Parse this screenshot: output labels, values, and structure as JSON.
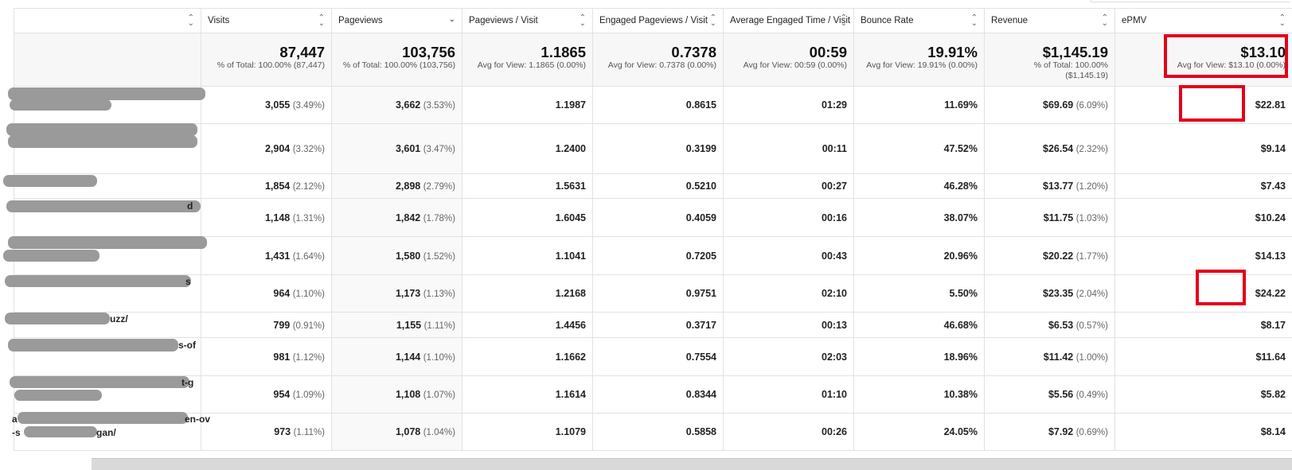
{
  "columns": [
    {
      "label": "",
      "sort": "both"
    },
    {
      "label": "Visits",
      "sort": "both"
    },
    {
      "label": "Pageviews",
      "sort": "down"
    },
    {
      "label": "Pageviews / Visit",
      "sort": "both"
    },
    {
      "label": "Engaged Pageviews / Visit",
      "sort": "both"
    },
    {
      "label": "Average Engaged Time / Visit",
      "sort": "both"
    },
    {
      "label": "Bounce Rate",
      "sort": "both"
    },
    {
      "label": "Revenue",
      "sort": "both"
    },
    {
      "label": "ePMV",
      "sort": "both"
    }
  ],
  "totals": {
    "visits": {
      "value": "87,447",
      "sub": "% of Total: 100.00% (87,447)"
    },
    "pageviews": {
      "value": "103,756",
      "sub": "% of Total: 100.00% (103,756)"
    },
    "pv_visit": {
      "value": "1.1865",
      "sub": "Avg for View: 1.1865 (0.00%)"
    },
    "engaged_pv": {
      "value": "0.7378",
      "sub": "Avg for View: 0.7378 (0.00%)"
    },
    "engaged_time": {
      "value": "00:59",
      "sub": "Avg for View: 00:59 (0.00%)"
    },
    "bounce": {
      "value": "19.91%",
      "sub": "Avg for View: 19.91% (0.00%)"
    },
    "revenue": {
      "value": "$1,145.19",
      "sub": "% of Total: 100.00%",
      "sub2": "($1,145.19)"
    },
    "epmv": {
      "value": "$13.10",
      "sub": "Avg for View: $13.10 (0.00%)"
    }
  },
  "rows": [
    {
      "visits": "3,055",
      "visits_pct": "(3.49%)",
      "pageviews": "3,662",
      "pageviews_pct": "(3.53%)",
      "pv_visit": "1.1987",
      "engaged_pv": "0.8615",
      "engaged_time": "01:29",
      "bounce": "11.69%",
      "revenue": "$69.69",
      "revenue_pct": "(6.09%)",
      "epmv": "$22.81"
    },
    {
      "visits": "2,904",
      "visits_pct": "(3.32%)",
      "pageviews": "3,601",
      "pageviews_pct": "(3.47%)",
      "pv_visit": "1.2400",
      "engaged_pv": "0.3199",
      "engaged_time": "00:11",
      "bounce": "47.52%",
      "revenue": "$26.54",
      "revenue_pct": "(2.32%)",
      "epmv": "$9.14"
    },
    {
      "visits": "1,854",
      "visits_pct": "(2.12%)",
      "pageviews": "2,898",
      "pageviews_pct": "(2.79%)",
      "pv_visit": "1.5631",
      "engaged_pv": "0.5210",
      "engaged_time": "00:27",
      "bounce": "46.28%",
      "revenue": "$13.77",
      "revenue_pct": "(1.20%)",
      "epmv": "$7.43"
    },
    {
      "visits": "1,148",
      "visits_pct": "(1.31%)",
      "pageviews": "1,842",
      "pageviews_pct": "(1.78%)",
      "pv_visit": "1.6045",
      "engaged_pv": "0.4059",
      "engaged_time": "00:16",
      "bounce": "38.07%",
      "revenue": "$11.75",
      "revenue_pct": "(1.03%)",
      "epmv": "$10.24"
    },
    {
      "visits": "1,431",
      "visits_pct": "(1.64%)",
      "pageviews": "1,580",
      "pageviews_pct": "(1.52%)",
      "pv_visit": "1.1041",
      "engaged_pv": "0.7205",
      "engaged_time": "00:43",
      "bounce": "20.96%",
      "revenue": "$20.22",
      "revenue_pct": "(1.77%)",
      "epmv": "$14.13"
    },
    {
      "visits": "964",
      "visits_pct": "(1.10%)",
      "pageviews": "1,173",
      "pageviews_pct": "(1.13%)",
      "pv_visit": "1.2168",
      "engaged_pv": "0.9751",
      "engaged_time": "02:10",
      "bounce": "5.50%",
      "revenue": "$23.35",
      "revenue_pct": "(2.04%)",
      "epmv": "$24.22"
    },
    {
      "visits": "799",
      "visits_pct": "(0.91%)",
      "pageviews": "1,155",
      "pageviews_pct": "(1.11%)",
      "pv_visit": "1.4456",
      "engaged_pv": "0.3717",
      "engaged_time": "00:13",
      "bounce": "46.68%",
      "revenue": "$6.53",
      "revenue_pct": "(0.57%)",
      "epmv": "$8.17"
    },
    {
      "visits": "981",
      "visits_pct": "(1.12%)",
      "pageviews": "1,144",
      "pageviews_pct": "(1.10%)",
      "pv_visit": "1.1662",
      "engaged_pv": "0.7554",
      "engaged_time": "02:03",
      "bounce": "18.96%",
      "revenue": "$11.42",
      "revenue_pct": "(1.00%)",
      "epmv": "$11.64"
    },
    {
      "visits": "954",
      "visits_pct": "(1.09%)",
      "pageviews": "1,108",
      "pageviews_pct": "(1.07%)",
      "pv_visit": "1.1614",
      "engaged_pv": "0.8344",
      "engaged_time": "01:10",
      "bounce": "10.38%",
      "revenue": "$5.56",
      "revenue_pct": "(0.49%)",
      "epmv": "$5.82"
    },
    {
      "visits": "973",
      "visits_pct": "(1.11%)",
      "pageviews": "1,078",
      "pageviews_pct": "(1.04%)",
      "pv_visit": "1.1079",
      "engaged_pv": "0.5858",
      "engaged_time": "00:26",
      "bounce": "24.05%",
      "revenue": "$7.92",
      "revenue_pct": "(0.69%)",
      "epmv": "$8.14"
    }
  ],
  "visible_page_fragments": [
    "uzz/",
    "s-of",
    "t-g",
    "en-ov",
    "a",
    "-s",
    "gan/",
    "s",
    "d"
  ],
  "colors": {
    "highlight": "#e3001b",
    "redaction": "#9a9a9a"
  }
}
